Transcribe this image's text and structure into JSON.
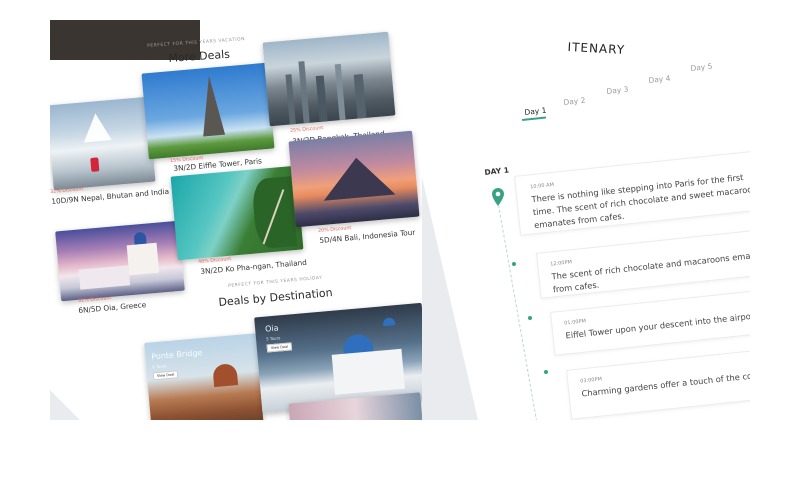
{
  "deals": {
    "kicker": "PERFECT FOR THIS YEARS VACATION",
    "title": "More Deals",
    "items": [
      {
        "discount": "32% Discount",
        "caption": "10D/9N Nepal, Bhutan and India"
      },
      {
        "discount": "15% Discount",
        "caption": "3N/2D Eiffle Tower, Paris"
      },
      {
        "discount": "25% Discount",
        "caption": "3N/2D Bangkok, Thailand"
      },
      {
        "discount": "31% Discount",
        "caption": "6N/5D Oia, Greece"
      },
      {
        "discount": "48% Discount",
        "caption": "3N/2D Ko Pha-ngan, Thailand"
      },
      {
        "discount": "20% Discount",
        "caption": "5D/4N Bali, Indonesia Tour"
      }
    ]
  },
  "destinations": {
    "kicker": "PERFECT FOR THIS YEARS HOLIDAY",
    "title": "Deals by Destination",
    "items": [
      {
        "name": "Ponte Bridge",
        "sub": "8 Tours",
        "button": "View Deal"
      },
      {
        "name": "Oia",
        "sub": "5 Tours",
        "button": "View Deal"
      }
    ]
  },
  "itinerary": {
    "title": "ITENARY",
    "tabs": [
      "Day 1",
      "Day 2",
      "Day 3",
      "Day 4",
      "Day 5"
    ],
    "active_tab": 0,
    "day_label": "DAY 1",
    "events": [
      {
        "time": "10:00 AM",
        "text": "There is nothing like stepping into Paris for the first time. The scent of rich chocolate and sweet macaroons emanates from cafes."
      },
      {
        "time": "12:00PM",
        "text": "The scent of rich chocolate and macaroons emanates from cafes."
      },
      {
        "time": "01:00PM",
        "text": "Eiffel Tower upon your descent into the airport."
      },
      {
        "time": "03:00PM",
        "text": "Charming gardens offer a touch of the countryside"
      }
    ]
  },
  "colors": {
    "accent": "#3aa283",
    "discount": "#e06a5c"
  }
}
